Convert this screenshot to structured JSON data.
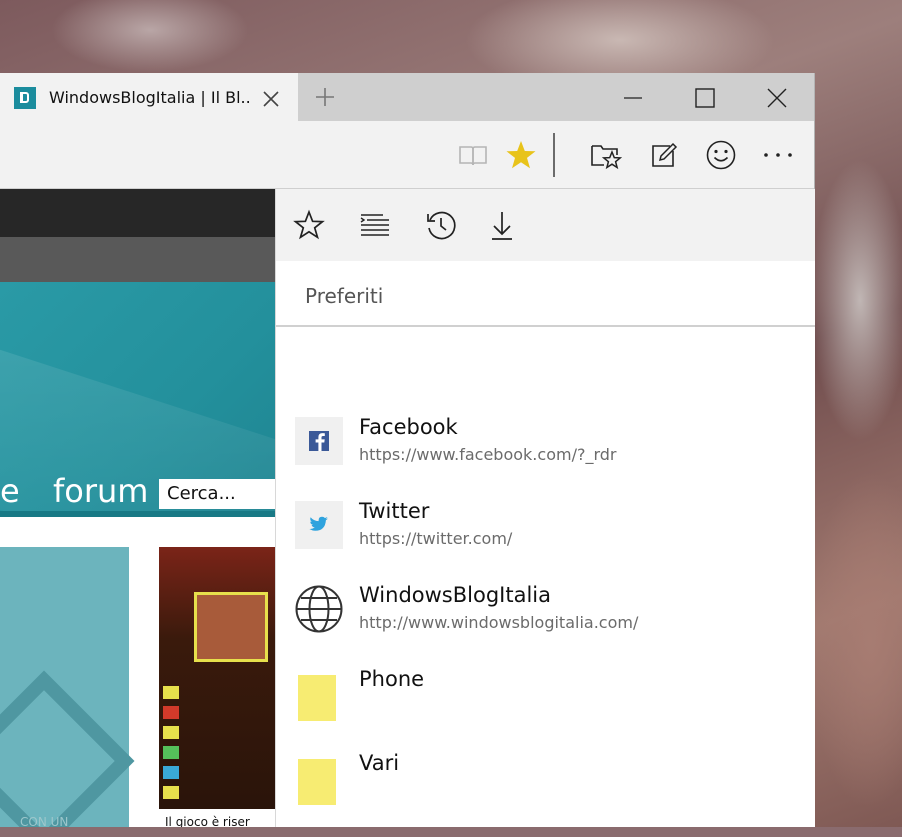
{
  "tab": {
    "title": "WindowsBlogItalia | Il Bl...",
    "favicon_color": "#1b8c9d"
  },
  "toolbar": {
    "icons": [
      "reading-view-icon",
      "favorite-star-icon",
      "hub-icon",
      "web-note-icon",
      "feedback-smiley-icon",
      "more-icon"
    ],
    "star_color": "#e8c31a"
  },
  "page": {
    "nav_partial": "e",
    "nav_forum": "forum",
    "search_placeholder": "Cerca...",
    "caption_left": "CON   UN",
    "caption_right": "Il   gioco   è   riser"
  },
  "hub": {
    "tabs": [
      "favorites-icon",
      "reading-list-icon",
      "history-icon",
      "downloads-icon"
    ],
    "heading": "Preferiti",
    "items": [
      {
        "name": "Facebook",
        "url": "https://www.facebook.com/?_rdr",
        "icon": "facebook-icon"
      },
      {
        "name": "Twitter",
        "url": "https://twitter.com/",
        "icon": "twitter-icon"
      },
      {
        "name": "WindowsBlogItalia",
        "url": "http://www.windowsblogitalia.com/",
        "icon": "globe-icon"
      },
      {
        "name": "Phone",
        "url": "",
        "icon": "folder-icon"
      },
      {
        "name": "Vari",
        "url": "",
        "icon": "folder-icon"
      }
    ],
    "folder_color": "#f7ec72"
  }
}
